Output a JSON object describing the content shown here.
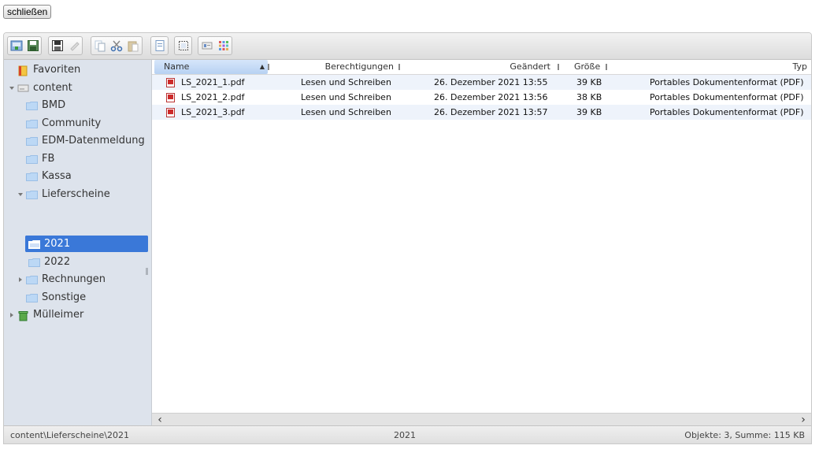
{
  "close_button": "schließen",
  "sidebar": {
    "favorites": "Favoriten",
    "root": "content",
    "items": [
      "BMD",
      "Community",
      "EDM-Datenmeldung",
      "FB",
      "Kassa",
      "Lieferscheine",
      "2021",
      "2022",
      "Rechnungen",
      "Sonstige"
    ],
    "trash": "Mülleimer"
  },
  "columns": {
    "name": "Name",
    "permissions": "Berechtigungen",
    "modified": "Geändert",
    "size": "Größe",
    "type": "Typ"
  },
  "files": [
    {
      "name": "LS_2021_1.pdf",
      "permissions": "Lesen und Schreiben",
      "modified": "26. Dezember 2021 13:55",
      "size": "39 KB",
      "type": "Portables Dokumentenformat (PDF)"
    },
    {
      "name": "LS_2021_2.pdf",
      "permissions": "Lesen und Schreiben",
      "modified": "26. Dezember 2021 13:56",
      "size": "38 KB",
      "type": "Portables Dokumentenformat (PDF)"
    },
    {
      "name": "LS_2021_3.pdf",
      "permissions": "Lesen und Schreiben",
      "modified": "26. Dezember 2021 13:57",
      "size": "39 KB",
      "type": "Portables Dokumentenformat (PDF)"
    }
  ],
  "status": {
    "path": "content\\Lieferscheine\\2021",
    "current": "2021",
    "summary": "Objekte: 3, Summe: 115 KB"
  },
  "colors": {
    "accent": "#3a78d8",
    "sidebar_bg": "#dde3ec",
    "row_alt": "#eef3fb",
    "folder": "#bcd8f5"
  }
}
